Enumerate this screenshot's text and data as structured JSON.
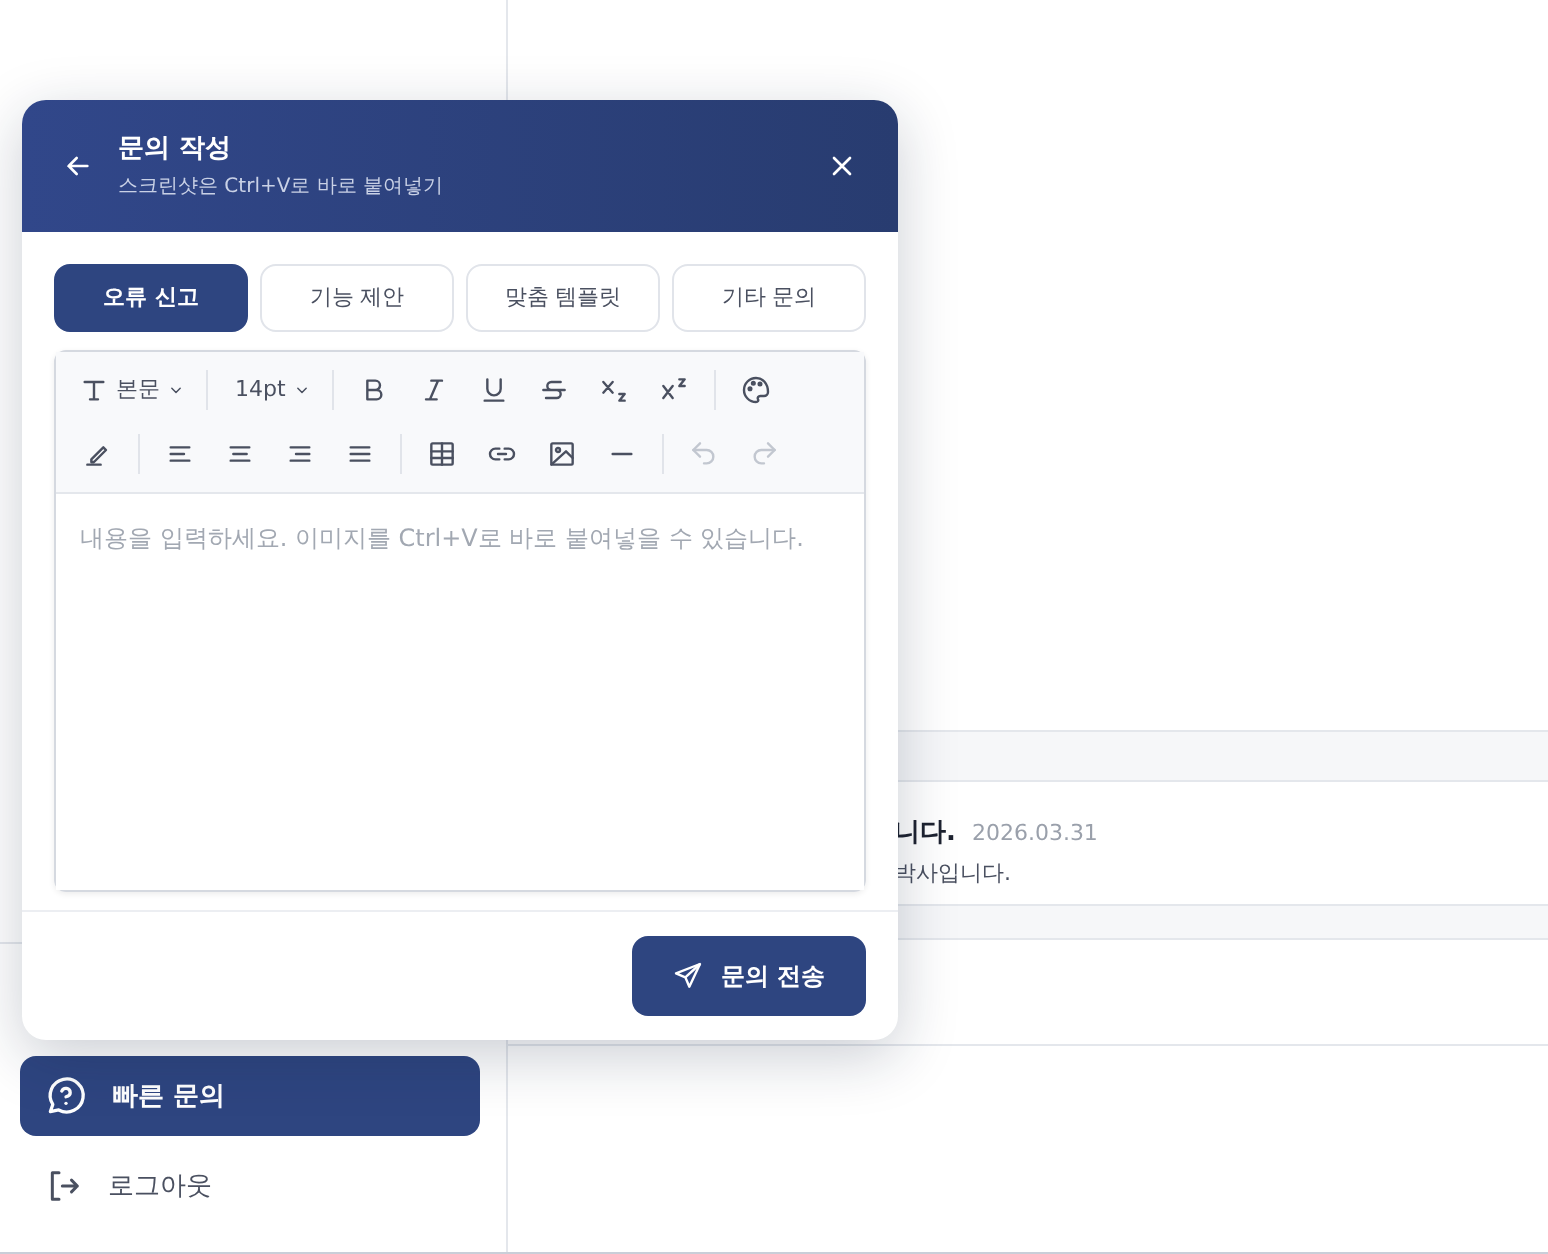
{
  "sidebar": {
    "items": [
      {
        "label": "빠른 문의",
        "selected": true
      },
      {
        "label": "로그아웃",
        "selected": false
      }
    ]
  },
  "notices": [
    {
      "title": "니다.",
      "date": "2026.03.31",
      "body": "박사입니다."
    }
  ],
  "dialog": {
    "title": "문의 작성",
    "subtitle": "스크린샷은 Ctrl+V로 바로 붙여넣기",
    "tabs": [
      {
        "label": "오류 신고",
        "selected": true
      },
      {
        "label": "기능 제안",
        "selected": false
      },
      {
        "label": "맞춤 템플릿",
        "selected": false
      },
      {
        "label": "기타 문의",
        "selected": false
      }
    ],
    "toolbar": {
      "font_style": "본문",
      "font_size": "14pt",
      "history_disabled": true
    },
    "editor": {
      "placeholder": "내용을 입력하세요. 이미지를 Ctrl+V로 바로 붙여넣을 수 있습니다."
    },
    "submit": "문의 전송"
  }
}
